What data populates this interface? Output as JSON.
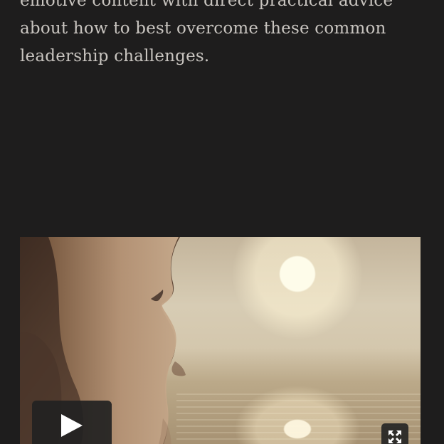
{
  "article": {
    "lines": [
      "emotive content with direct practical advice",
      "about how to best overcome these common",
      "leadership challenges."
    ]
  },
  "video": {
    "controls": {
      "play_icon": "play-icon",
      "fullscreen_icon": "fullscreen-expand-icon"
    }
  }
}
